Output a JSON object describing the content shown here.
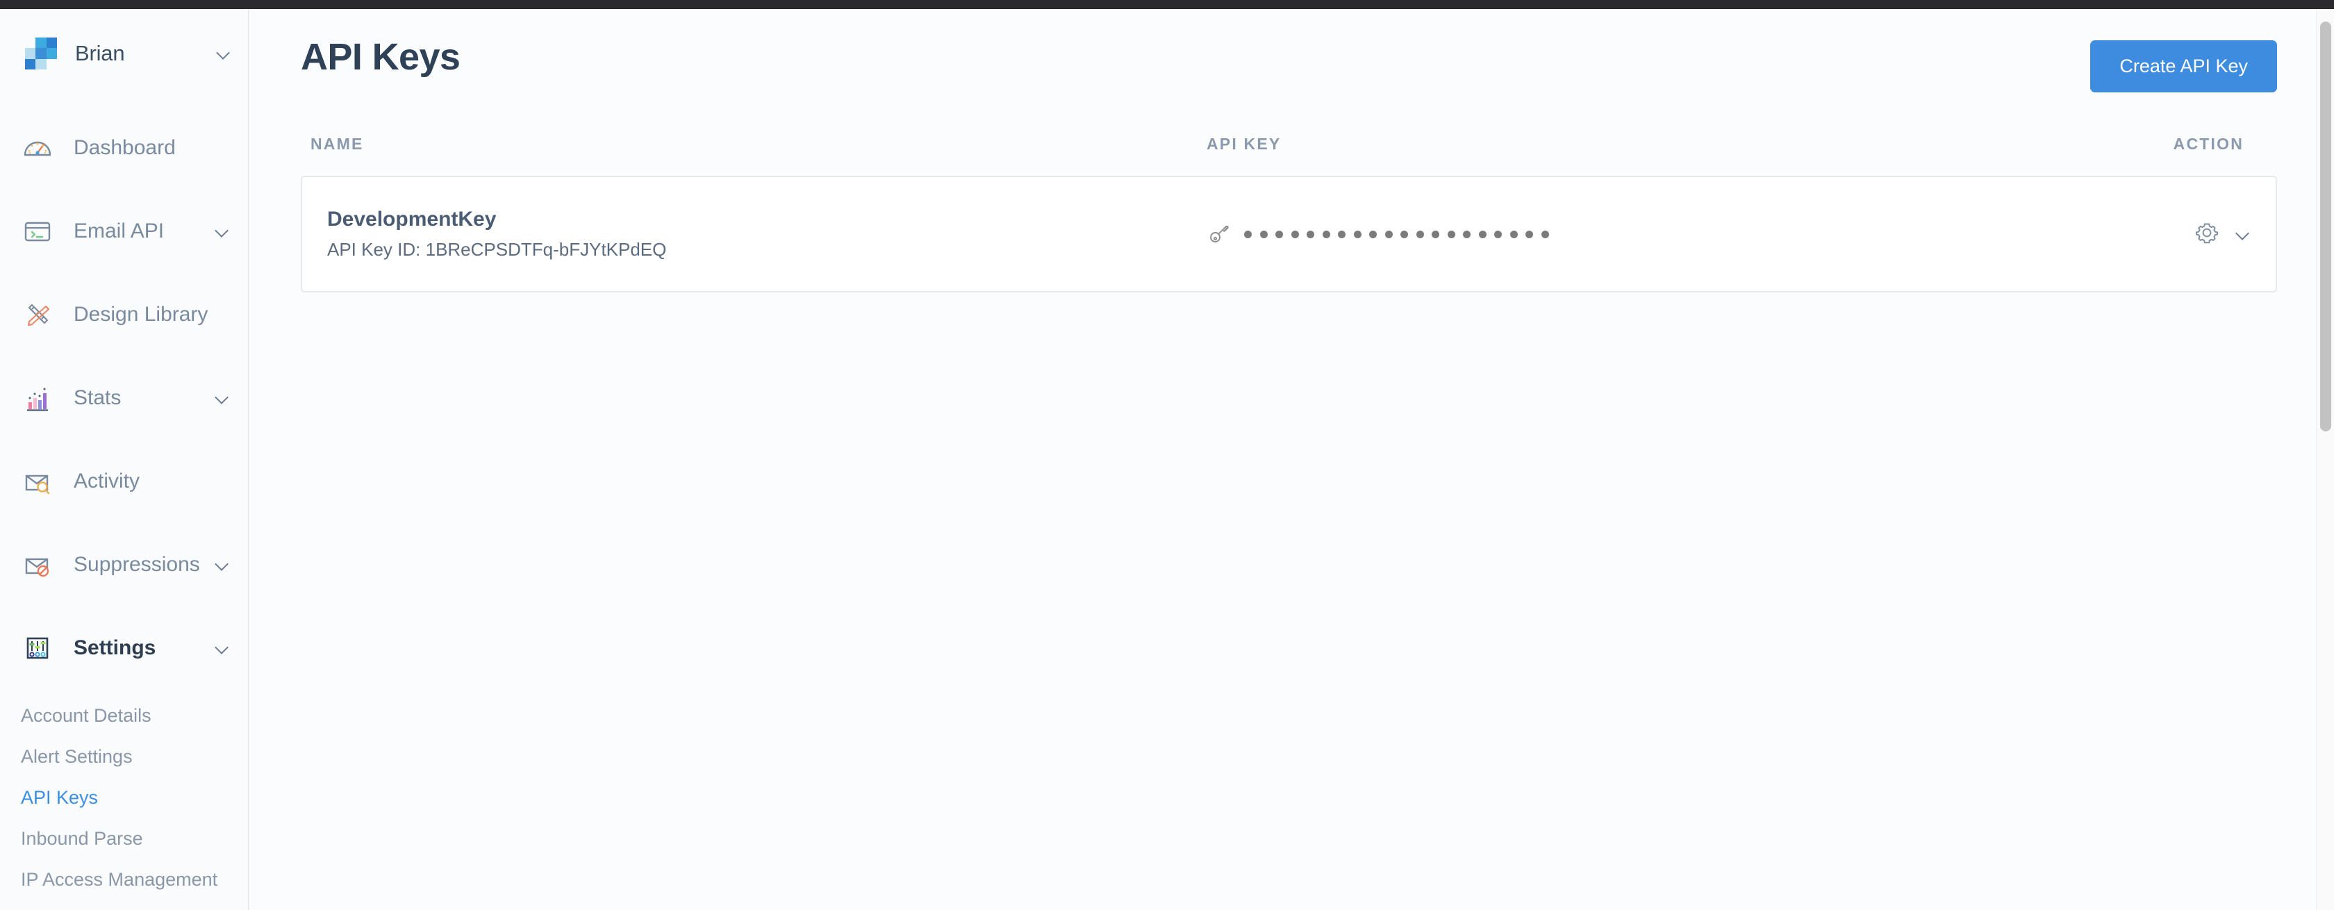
{
  "account": {
    "name": "Brian",
    "caret_icon": "chevron-down-icon",
    "logo_icon": "sendgrid-logo-icon"
  },
  "sidebar": {
    "items": [
      {
        "label": "Dashboard",
        "icon": "gauge-icon",
        "has_caret": false
      },
      {
        "label": "Email API",
        "icon": "code-window-icon",
        "has_caret": true
      },
      {
        "label": "Design Library",
        "icon": "pencil-ruler-icon",
        "has_caret": false
      },
      {
        "label": "Stats",
        "icon": "bar-chart-icon",
        "has_caret": true
      },
      {
        "label": "Activity",
        "icon": "envelope-search-icon",
        "has_caret": false
      },
      {
        "label": "Suppressions",
        "icon": "envelope-blocked-icon",
        "has_caret": true
      },
      {
        "label": "Settings",
        "icon": "sliders-icon",
        "has_caret": true
      }
    ],
    "settings_submenu": [
      {
        "label": "Account Details",
        "current": false
      },
      {
        "label": "Alert Settings",
        "current": false
      },
      {
        "label": "API Keys",
        "current": true
      },
      {
        "label": "Inbound Parse",
        "current": false
      },
      {
        "label": "IP Access Management",
        "current": false
      }
    ]
  },
  "header": {
    "title": "API Keys",
    "create_button": "Create API Key"
  },
  "table": {
    "columns": [
      "NAME",
      "API KEY",
      "ACTION"
    ],
    "rows": [
      {
        "name": "DevelopmentKey",
        "key_id": "API Key ID: 1BReCPSDTFq-bFJYtKPdEQ",
        "key_icon": "key-icon",
        "masked_key_dots": 20,
        "action_gear_icon": "gear-icon",
        "action_caret_icon": "chevron-down-icon"
      }
    ]
  },
  "colors": {
    "accent": "#3d8ce0",
    "link": "#3b8ee0",
    "title": "#2f4156",
    "muted": "#8a99ac"
  }
}
